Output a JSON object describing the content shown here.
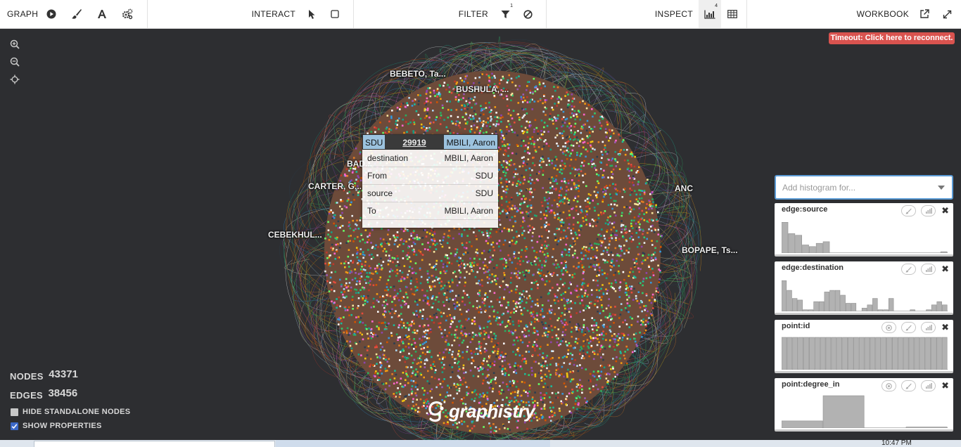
{
  "toolbar": {
    "graph": {
      "label": "GRAPH",
      "buttons": [
        "play-icon",
        "brush-icon",
        "font-icon",
        "gears-icon"
      ]
    },
    "interact": {
      "label": "INTERACT",
      "buttons": [
        "pointer-icon",
        "select-box-icon"
      ]
    },
    "filter": {
      "label": "FILTER",
      "badge": "1",
      "buttons": [
        "funnel-icon",
        "exclude-icon"
      ]
    },
    "inspect": {
      "label": "INSPECT",
      "badge": "4",
      "buttons": [
        "histogram-icon",
        "table-icon"
      ]
    },
    "workbook": {
      "label": "WORKBOOK",
      "buttons": [
        "external-link-icon",
        "fullscreen-icon"
      ]
    }
  },
  "zoom_controls": [
    "zoom-in-icon",
    "zoom-out-icon",
    "center-icon"
  ],
  "timeout_banner": "Timeout: Click here to reconnect.",
  "cluster_labels": [
    "BEBETO, Ta...",
    "BUSHULA, ...",
    "BAD...",
    "CARTER, G...",
    "CEBEKHUL...",
    "ANC",
    "BOPAPE, Ts..."
  ],
  "tooltip": {
    "source": "SDU",
    "id": "29919",
    "destination": "MBILI, Aaron",
    "rows": [
      {
        "key": "destination",
        "value": "MBILI, Aaron"
      },
      {
        "key": "From",
        "value": "SDU"
      },
      {
        "key": "source",
        "value": "SDU"
      },
      {
        "key": "To",
        "value": "MBILI, Aaron"
      }
    ]
  },
  "histogram_panel": {
    "placeholder": "Add histogram for...",
    "cards": [
      {
        "title": "edge:source",
        "controls": [
          "brush-icon",
          "histogram-icon"
        ],
        "bars": [
          0.95,
          0.6,
          0.55,
          0.25,
          0.2,
          0.3,
          0.35,
          0,
          0,
          0,
          0,
          0,
          0,
          0,
          0,
          0,
          0,
          0,
          0,
          0,
          0,
          0,
          0,
          0.04
        ]
      },
      {
        "title": "edge:destination",
        "controls": [
          "brush-icon",
          "histogram-icon"
        ],
        "bars": [
          0.95,
          0.65,
          0.4,
          0.35,
          0.05,
          0.05,
          0.3,
          0.3,
          0.6,
          0.65,
          0.65,
          0.5,
          0.25,
          0.25,
          0,
          0.1,
          0.2,
          0.4,
          0.05,
          0.05,
          0.4,
          0,
          0,
          0,
          0.05,
          0,
          0,
          0.05,
          0.2,
          0.3,
          0.2
        ]
      },
      {
        "title": "point:id",
        "controls": [
          "target-icon",
          "brush-icon",
          "histogram-icon"
        ],
        "bars": [
          1,
          1,
          1,
          1,
          1,
          1,
          1,
          1,
          1,
          1,
          1,
          1,
          1,
          1,
          1,
          1,
          1,
          1,
          1,
          1,
          1,
          1,
          1,
          1,
          1,
          1,
          1,
          1,
          1,
          1
        ]
      },
      {
        "title": "point:degree_in",
        "controls": [
          "target-icon",
          "brush-icon",
          "histogram-icon"
        ],
        "bars": [
          0.22,
          1,
          0,
          0.03
        ]
      }
    ]
  },
  "stats": {
    "nodes_label": "NODES",
    "nodes": "43371",
    "edges_label": "EDGES",
    "edges": "38456",
    "hide_standalone": "HIDE STANDALONE NODES",
    "show_properties": "SHOW PROPERTIES"
  },
  "logo": "graphistry",
  "clock": "10:47 PM",
  "colors": {
    "accent": "#5b9bd5",
    "alert": "#d9534f",
    "canvas": "#2d2e31",
    "tooltip_header": "#9cc3df"
  }
}
